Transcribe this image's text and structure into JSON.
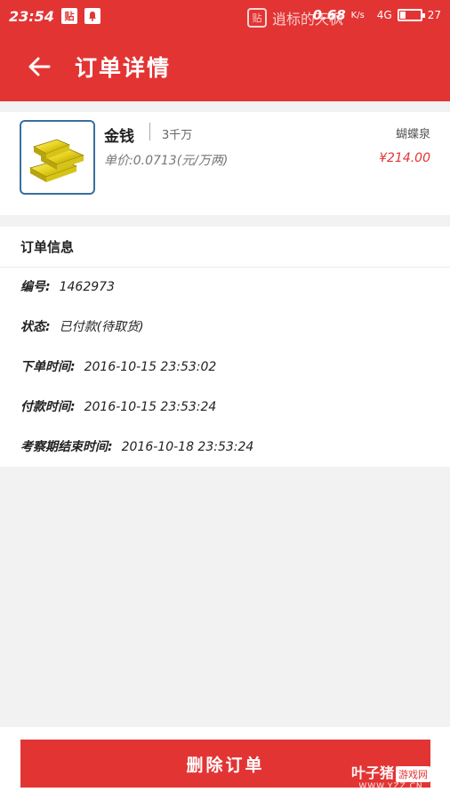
{
  "status_bar": {
    "time": "23:54",
    "notif_icon_1": "贴",
    "notif_icon_2": "bell-icon",
    "network_speed": "0.68",
    "network_unit": "K/s",
    "signal": "4G",
    "battery_level": "27",
    "battery_fraction": 0.27
  },
  "watermark_top": {
    "text": "逍标的天枫"
  },
  "header": {
    "title": "订单详情"
  },
  "product": {
    "name": "金钱",
    "quantity": "3千万",
    "unit_price": "单价:0.0713(元/万两)",
    "server": "蝴蝶泉",
    "total": "¥214.00",
    "image_icon": "gold-bars-icon"
  },
  "order_info": {
    "section_title": "订单信息",
    "rows": [
      {
        "label": "编号:",
        "value": "1462973"
      },
      {
        "label": "状态:",
        "value": "已付款(待取货)"
      },
      {
        "label": "下单时间:",
        "value": "2016-10-15  23:53:02"
      },
      {
        "label": "付款时间:",
        "value": "2016-10-15  23:53:24"
      },
      {
        "label": "考察期结束时间:",
        "value": "2016-10-18  23:53:24"
      }
    ]
  },
  "footer": {
    "delete_label": "删除订单"
  },
  "watermark_bottom": {
    "brand": "叶子猪",
    "tag": "游戏网",
    "url": "WWW.YZZ.CN"
  },
  "colors": {
    "accent": "#e33434",
    "background": "#f2f2f2"
  }
}
